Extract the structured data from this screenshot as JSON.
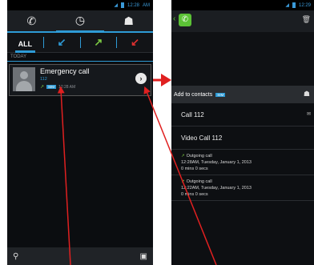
{
  "left": {
    "status_time": "12:28",
    "status_ampm": "AM",
    "tabs": [
      "phone-icon",
      "clock-icon",
      "contacts-icon"
    ],
    "filter": {
      "all": "ALL",
      "in": "↙",
      "out": "↗",
      "missed": "↙"
    },
    "section": "TODAY",
    "entry": {
      "name": "Emergency call",
      "number": "112",
      "sim": "SIM",
      "time": "12:28 AM",
      "detail_glyph": "›"
    },
    "bottom": {
      "search": "⚲",
      "menu": "▣"
    }
  },
  "right": {
    "status_time": "12:29",
    "add_to_contacts": "Add to contacts",
    "sim": "SIM",
    "call_label": "Call 112",
    "video_call_label": "Video Call 112",
    "history": [
      {
        "type": "Outgoing call",
        "datetime": "12:28AM, Tuesday, January 1, 2013",
        "duration": "0 mins 0 secs"
      },
      {
        "type": "Outgoing call",
        "datetime": "12:22AM, Tuesday, January 1, 2013",
        "duration": "0 mins 0 secs"
      }
    ]
  },
  "colors": {
    "accent": "#2e9bd6",
    "outgoing": "#7ac943",
    "missed": "#e03030",
    "annotation": "#e02020"
  }
}
